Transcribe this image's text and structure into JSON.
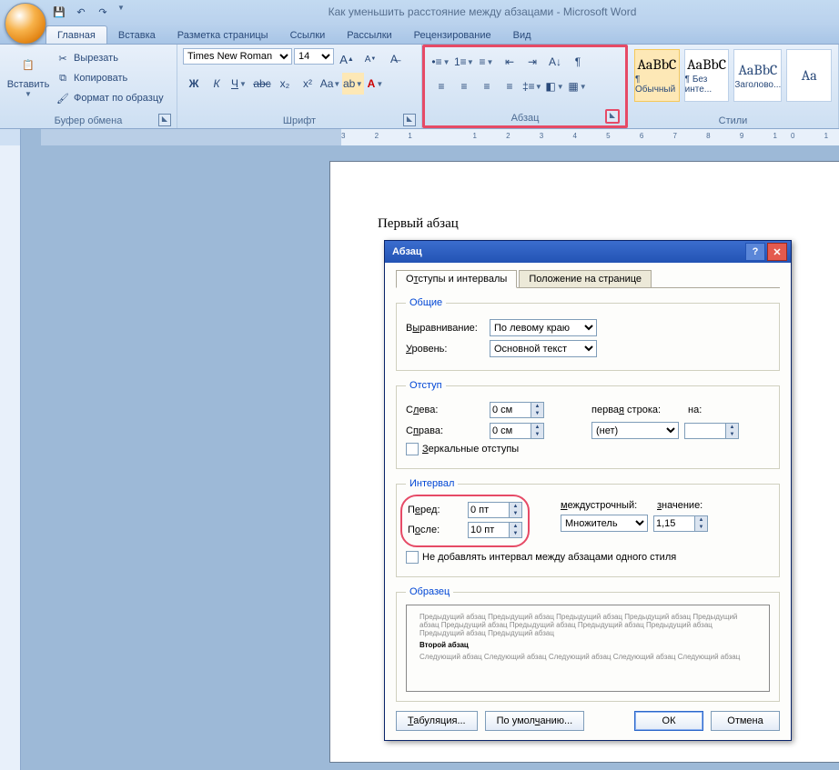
{
  "title": "Как уменьшить расстояние между абзацами - Microsoft Word",
  "tabs": [
    "Главная",
    "Вставка",
    "Разметка страницы",
    "Ссылки",
    "Рассылки",
    "Рецензирование",
    "Вид"
  ],
  "clipboard": {
    "title": "Буфер обмена",
    "paste": "Вставить",
    "cut": "Вырезать",
    "copy": "Копировать",
    "painter": "Формат по образцу"
  },
  "font": {
    "title": "Шрифт",
    "name": "Times New Roman",
    "size": "14"
  },
  "paragraph": {
    "title": "Абзац"
  },
  "styles": {
    "title": "Стили",
    "items": [
      {
        "prev": "AaBbC",
        "name": "¶ Обычный"
      },
      {
        "prev": "AaBbC",
        "name": "¶ Без инте..."
      },
      {
        "prev": "AaBbC",
        "name": "Заголово..."
      },
      {
        "prev": "Aa",
        "name": ""
      }
    ]
  },
  "doc": {
    "p1": "Первый абзац"
  },
  "dialog": {
    "title": "Абзац",
    "tab1": "Отступы и интервалы",
    "tab2": "Положение на странице",
    "general": "Общие",
    "align_l": "Выравнивание:",
    "align_v": "По левому краю",
    "level_l": "Уровень:",
    "level_v": "Основной текст",
    "indent": "Отступ",
    "left_l": "Слева:",
    "left_v": "0 см",
    "right_l": "Справа:",
    "right_v": "0 см",
    "first_l": "первая строка:",
    "first_v": "(нет)",
    "on_l": "на:",
    "mirror": "Зеркальные отступы",
    "spacing": "Интервал",
    "before_l": "Перед:",
    "before_v": "0 пт",
    "after_l": "После:",
    "after_v": "10 пт",
    "line_l": "междустрочный:",
    "line_v": "Множитель",
    "val_l": "значение:",
    "val_v": "1,15",
    "noadd": "Не добавлять интервал между абзацами одного стиля",
    "sample": "Образец",
    "prev_txt": "Предыдущий абзац Предыдущий абзац Предыдущий абзац Предыдущий абзац Предыдущий абзац Предыдущий абзац Предыдущий абзац Предыдущий абзац Предыдущий абзац Предыдущий абзац Предыдущий абзац",
    "cur_txt": "Второй абзац",
    "next_txt": "Следующий абзац Следующий абзац Следующий абзац Следующий абзац Следующий абзац",
    "tabs_btn": "Табуляция...",
    "def_btn": "По умолчанию...",
    "ok": "ОК",
    "cancel": "Отмена"
  }
}
